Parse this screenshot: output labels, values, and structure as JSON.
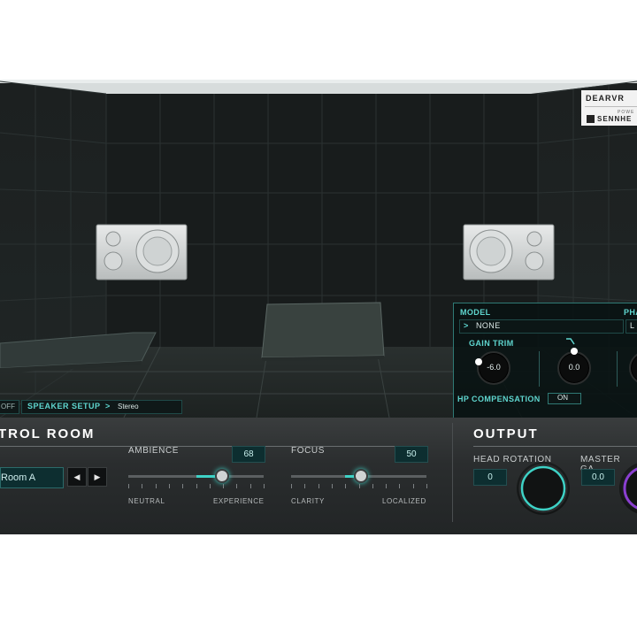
{
  "brand": {
    "product": "DEARVR",
    "powered": "POWE",
    "partner": "SENNHE"
  },
  "room": {
    "speaker_off": "OFF",
    "speaker_setup_label": "SPEAKER SETUP",
    "speaker_setup_arrow": ">",
    "speaker_setup_value": "Stereo"
  },
  "model_panel": {
    "model_label": "MODEL",
    "model_arrow": ">",
    "model_value": "NONE",
    "ph_label": "PHA",
    "ph_value": "L",
    "gain_trim_label": "GAIN TRIM",
    "gain_trim_value": "-6.0",
    "second_knob_value": "0.0",
    "hp_comp_label": "HP COMPENSATION",
    "hp_comp_value": "ON"
  },
  "control_room": {
    "title": "TROL ROOM",
    "room_value": "Room A",
    "prev_label": "◀",
    "next_label": "▶",
    "ambience": {
      "label": "AMBIENCE",
      "value": "68",
      "left": "NEUTRAL",
      "right": "EXPERIENCE",
      "level": 0.68
    },
    "focus": {
      "label": "FOCUS",
      "value": "50",
      "left": "CLARITY",
      "right": "LOCALIZED",
      "level": 0.5
    }
  },
  "output": {
    "title": "OUTPUT",
    "head_rotation": {
      "label": "HEAD ROTATION",
      "value": "0"
    },
    "master_gain": {
      "label": "MASTER GA",
      "value": "0.0"
    }
  },
  "colors": {
    "accent": "#3ed2c6",
    "panel": "#2a2d2e",
    "room": "#16191a",
    "master": "#8a3fd1"
  }
}
